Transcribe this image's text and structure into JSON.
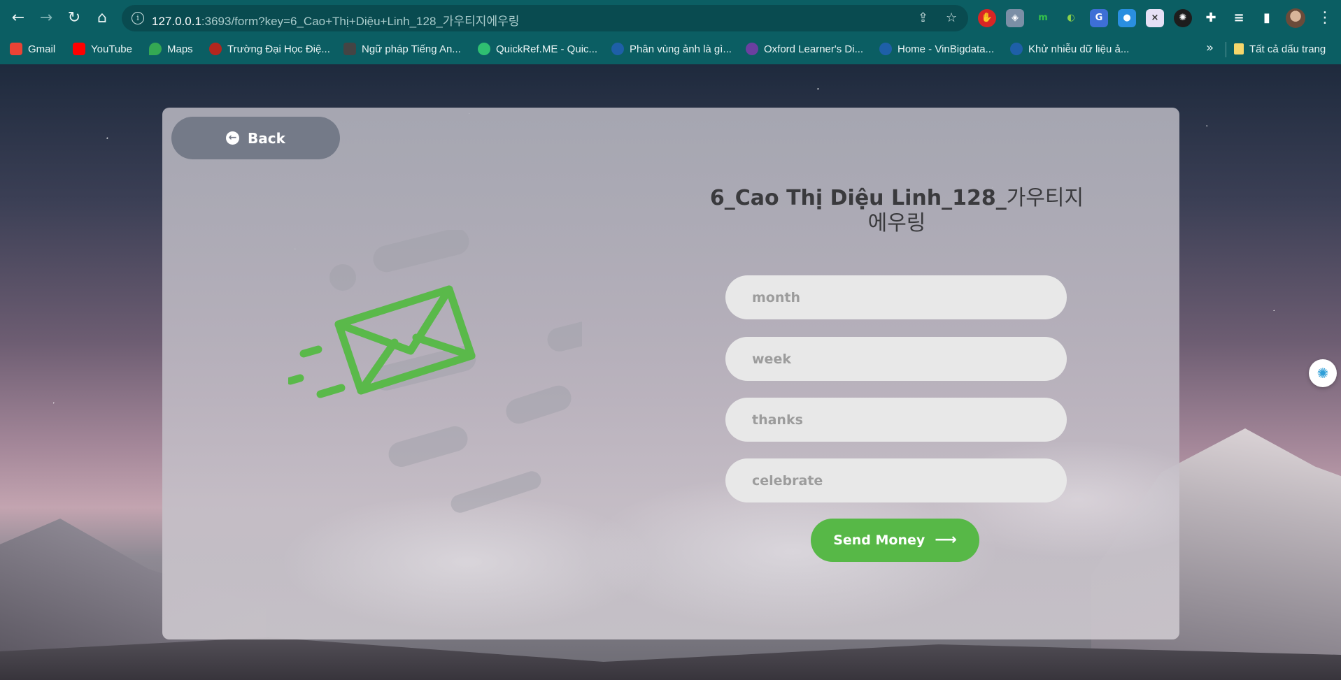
{
  "browser": {
    "url_host": "127.0.0.1",
    "url_rest": ":3693/form?key=6_Cao+Thị+Diệu+Linh_128_가우티지에우링",
    "bookmarks": [
      {
        "label": "Gmail",
        "color": "#ea4335"
      },
      {
        "label": "YouTube",
        "color": "#ff0000"
      },
      {
        "label": "Maps",
        "color": "#34a853"
      },
      {
        "label": "Trường Đại Học Điệ...",
        "color": "#b3261e"
      },
      {
        "label": "Ngữ pháp Tiếng An...",
        "color": "#444444"
      },
      {
        "label": "QuickRef.ME - Quic...",
        "color": "#2fbf71"
      },
      {
        "label": "Phân vùng ảnh là gì...",
        "color": "#1e5fa8"
      },
      {
        "label": "Oxford Learner's Di...",
        "color": "#6b3fa0"
      },
      {
        "label": "Home - VinBigdata...",
        "color": "#1e5fa8"
      },
      {
        "label": "Khử nhiễu dữ liệu ả...",
        "color": "#1e5fa8"
      }
    ],
    "more_label": "»",
    "all_bookmarks_label": "Tất cả dấu trang"
  },
  "page": {
    "back_label": "Back",
    "title_bold": "6_Cao Thị Diệu Linh_128_",
    "title_rest": "가우티지에우링",
    "fields": {
      "month_placeholder": "month",
      "week_placeholder": "week",
      "thanks_placeholder": "thanks",
      "celebrate_placeholder": "celebrate"
    },
    "send_label": "Send Money",
    "accent_color": "#57b847"
  }
}
